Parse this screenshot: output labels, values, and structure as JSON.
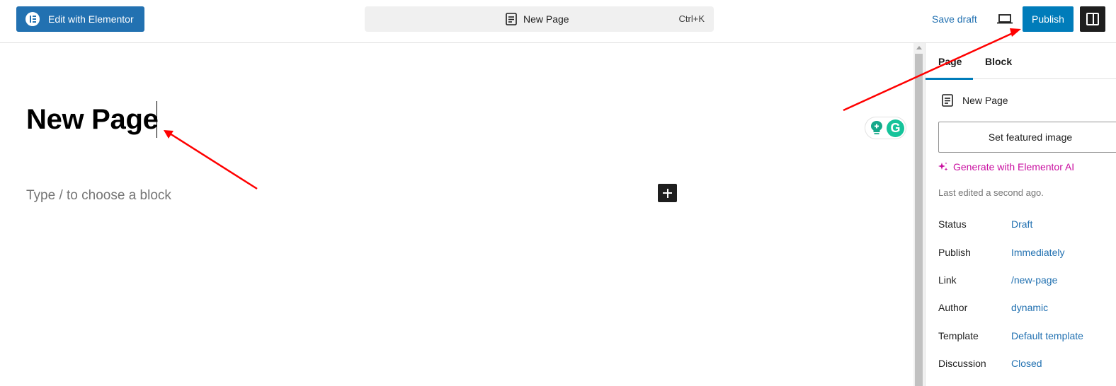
{
  "topbar": {
    "elementor_label": "Edit with Elementor",
    "command_title": "New Page",
    "command_shortcut": "Ctrl+K",
    "save_draft_label": "Save draft",
    "publish_label": "Publish"
  },
  "editor": {
    "title": "New Page",
    "block_placeholder": "Type / to choose a block"
  },
  "sidebar": {
    "tabs": [
      {
        "label": "Page",
        "active": true
      },
      {
        "label": "Block",
        "active": false
      }
    ],
    "document_title": "New Page",
    "featured_image_label": "Set featured image",
    "generate_ai_label": "Generate with Elementor AI",
    "last_edited": "Last edited a second ago.",
    "meta": [
      {
        "key": "Status",
        "value": "Draft"
      },
      {
        "key": "Publish",
        "value": "Immediately"
      },
      {
        "key": "Link",
        "value": "/new-page"
      },
      {
        "key": "Author",
        "value": "dynamic"
      },
      {
        "key": "Template",
        "value": "Default template"
      },
      {
        "key": "Discussion",
        "value": "Closed"
      }
    ]
  },
  "colors": {
    "accent": "#007cba",
    "link": "#2271b1",
    "ai_magenta": "#c90fa0",
    "annotation_arrow": "#ff0000"
  }
}
